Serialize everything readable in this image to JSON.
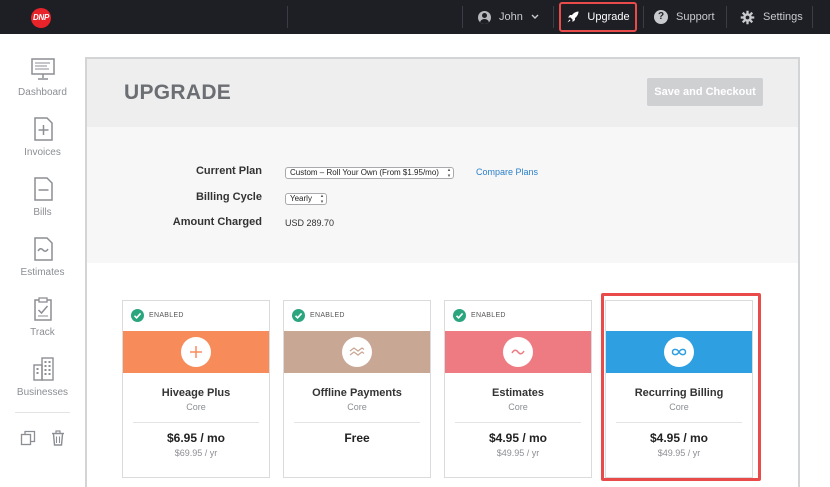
{
  "topbar": {
    "logo_text": "DNP",
    "user_name": "John",
    "upgrade_label": "Upgrade",
    "support_label": "Support",
    "settings_label": "Settings",
    "highlight_color": "#e94b4b"
  },
  "sidebar": {
    "items": [
      {
        "label": "Dashboard",
        "icon": "monitor-icon"
      },
      {
        "label": "Invoices",
        "icon": "invoice-plus-icon"
      },
      {
        "label": "Bills",
        "icon": "bill-minus-icon"
      },
      {
        "label": "Estimates",
        "icon": "estimate-wave-icon"
      },
      {
        "label": "Track",
        "icon": "clipboard-check-icon"
      },
      {
        "label": "Businesses",
        "icon": "building-icon"
      }
    ],
    "tools": [
      {
        "icon": "copy-icon"
      },
      {
        "icon": "trash-icon"
      }
    ]
  },
  "page": {
    "title": "UPGRADE",
    "checkout_label": "Save and Checkout"
  },
  "details": {
    "current_plan_label": "Current Plan",
    "current_plan_value": "Custom – Roll Your Own (From $1.95/mo)",
    "compare_link": "Compare Plans",
    "billing_cycle_label": "Billing Cycle",
    "billing_cycle_value": "Yearly",
    "amount_label": "Amount Charged",
    "amount_value": "USD 289.70"
  },
  "cards": [
    {
      "badge": "ENABLED",
      "name": "Hiveage Plus",
      "tier": "Core",
      "price": "$6.95 / mo",
      "yearly": "$69.95 / yr",
      "color": "#f78c5a",
      "icon": "plus-icon"
    },
    {
      "badge": "ENABLED",
      "name": "Offline Payments",
      "tier": "Core",
      "price": "Free",
      "yearly": "",
      "color": "#c9a795",
      "icon": "wave-icon"
    },
    {
      "badge": "ENABLED",
      "name": "Estimates",
      "tier": "Core",
      "price": "$4.95 / mo",
      "yearly": "$49.95 / yr",
      "color": "#ee7b82",
      "icon": "tilde-icon"
    },
    {
      "badge": "",
      "name": "Recurring Billing",
      "tier": "Core",
      "price": "$4.95 / mo",
      "yearly": "$49.95 / yr",
      "color": "#2e9fe0",
      "icon": "infinity-icon"
    }
  ]
}
